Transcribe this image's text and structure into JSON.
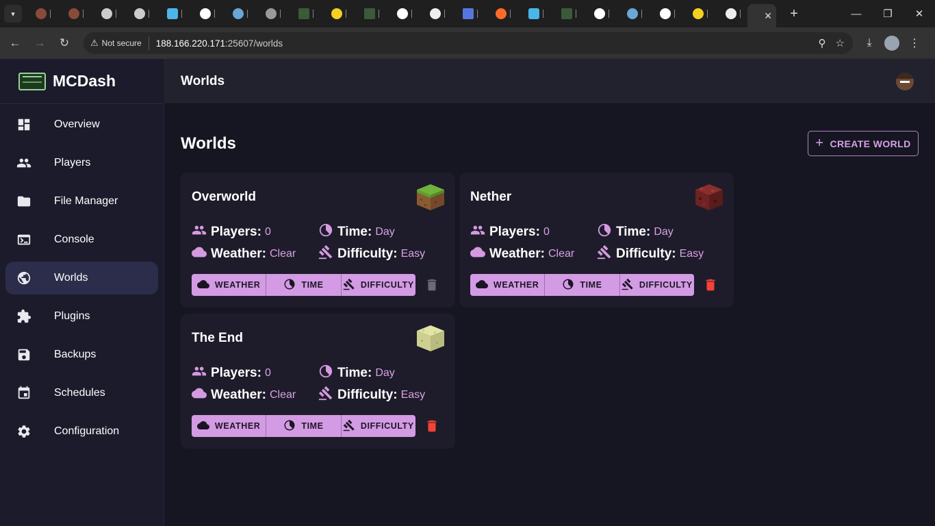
{
  "browser": {
    "not_secure_label": "Not secure",
    "url_host": "188.166.220.171",
    "url_rest": ":25607/worlds"
  },
  "app": {
    "brand": "MCDash",
    "page_title": "Worlds"
  },
  "sidebar": {
    "items": [
      {
        "label": "Overview",
        "icon": "dashboard-icon"
      },
      {
        "label": "Players",
        "icon": "people-icon"
      },
      {
        "label": "File Manager",
        "icon": "folder-icon"
      },
      {
        "label": "Console",
        "icon": "terminal-icon"
      },
      {
        "label": "Worlds",
        "icon": "globe-icon",
        "active": true
      },
      {
        "label": "Plugins",
        "icon": "puzzle-icon"
      },
      {
        "label": "Backups",
        "icon": "save-icon"
      },
      {
        "label": "Schedules",
        "icon": "calendar-icon"
      },
      {
        "label": "Configuration",
        "icon": "gear-icon"
      }
    ]
  },
  "main": {
    "heading": "Worlds",
    "create_label": "CREATE WORLD"
  },
  "labels": {
    "players": "Players:",
    "time": "Time:",
    "weather": "Weather:",
    "difficulty": "Difficulty:",
    "btn_weather": "WEATHER",
    "btn_time": "TIME",
    "btn_difficulty": "DIFFICULTY"
  },
  "worlds": [
    {
      "name": "Overworld",
      "players": "0",
      "time": "Day",
      "weather": "Clear",
      "difficulty": "Easy",
      "block": "grass-block",
      "delete_enabled": false
    },
    {
      "name": "Nether",
      "players": "0",
      "time": "Day",
      "weather": "Clear",
      "difficulty": "Easy",
      "block": "netherrack-block",
      "delete_enabled": true
    },
    {
      "name": "The End",
      "players": "0",
      "time": "Day",
      "weather": "Clear",
      "difficulty": "Easy",
      "block": "end-stone-block",
      "delete_enabled": true
    }
  ],
  "colors": {
    "accent": "#d39be3",
    "danger": "#f44336",
    "disabled": "#6b6b75"
  }
}
